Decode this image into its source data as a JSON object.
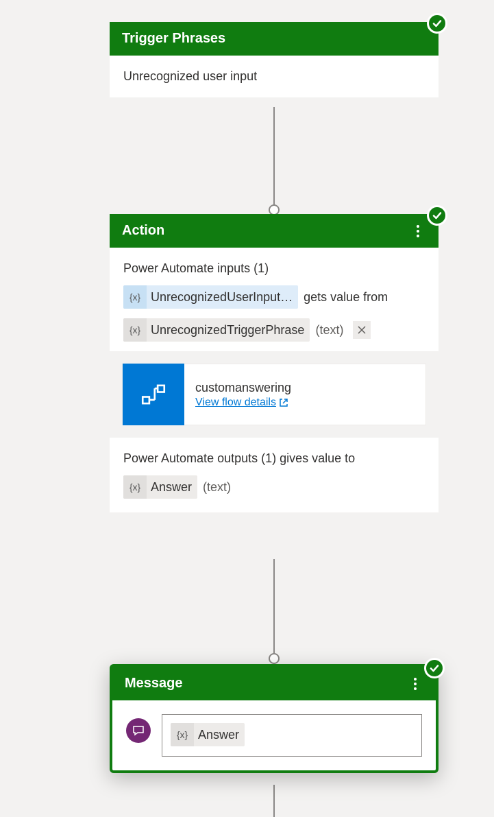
{
  "colors": {
    "accent_green": "#107c10",
    "link_blue": "#0078d4",
    "chat_purple": "#742774"
  },
  "trigger": {
    "title": "Trigger Phrases",
    "content": "Unrecognized user input"
  },
  "action": {
    "title": "Action",
    "inputs_label": "Power Automate inputs (1)",
    "input_var": "UnrecognizedUserInput…",
    "gets_from": "gets value from",
    "source_var": "UnrecognizedTriggerPhrase",
    "source_type": "(text)",
    "flow": {
      "name": "customanswering",
      "link_label": "View flow details"
    },
    "outputs_label": "Power Automate outputs (1) gives value to",
    "output_var": "Answer",
    "output_type": "(text)"
  },
  "message": {
    "title": "Message",
    "answer_chip": "Answer"
  }
}
